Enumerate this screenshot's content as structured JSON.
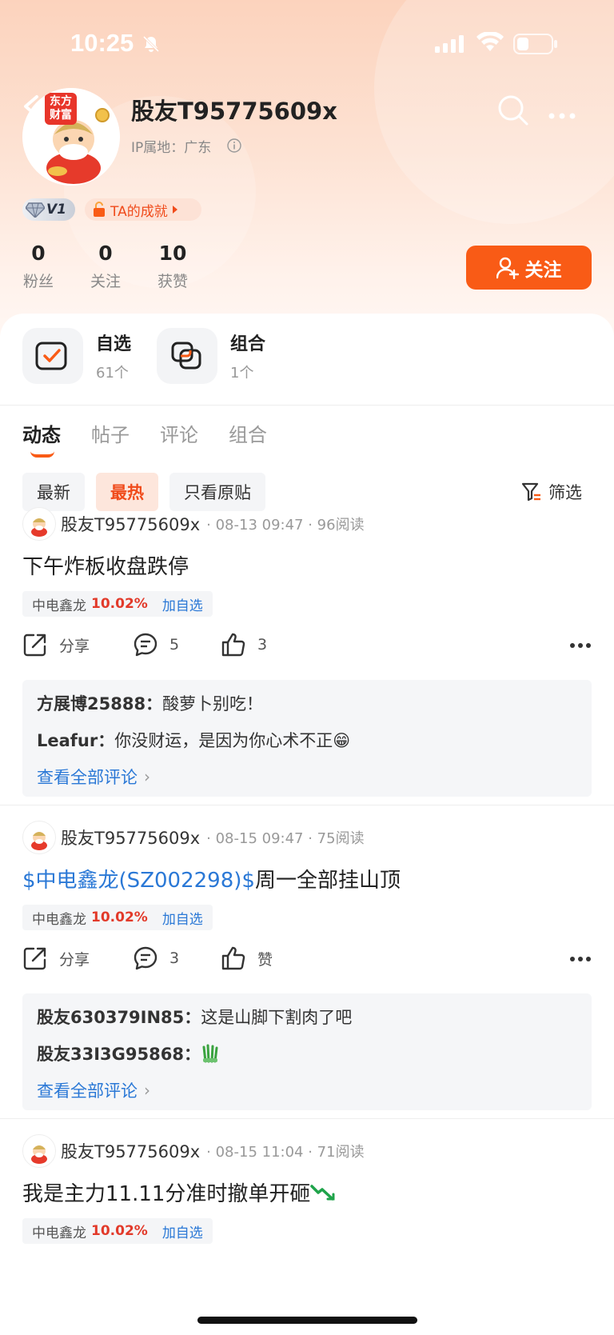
{
  "status_bar": {
    "time": "10:25"
  },
  "profile": {
    "username": "股友T95775609x",
    "ip_location": "IP属地：广东",
    "avatar_tag": "东方财富",
    "level_badge": "V1",
    "achievement_badge": "TA的成就",
    "stats": [
      {
        "value": "0",
        "label": "粉丝"
      },
      {
        "value": "0",
        "label": "关注"
      },
      {
        "value": "10",
        "label": "获赞"
      }
    ],
    "follow_button": "关注"
  },
  "quick_links": [
    {
      "title": "自选",
      "sub": "61个"
    },
    {
      "title": "组合",
      "sub": "1个"
    }
  ],
  "tabs": [
    "动态",
    "帖子",
    "评论",
    "组合"
  ],
  "filters": [
    "最新",
    "最热",
    "只看原贴"
  ],
  "filter_button": "筛选",
  "posts": [
    {
      "author": "股友T95775609x",
      "meta": "· 08-13 09:47 · 96阅读",
      "body": "下午炸板收盘跌停",
      "stock": {
        "name": "中电鑫龙",
        "pct": "10.02%",
        "add": "加自选"
      },
      "share": "分享",
      "comments_count": "5",
      "likes": "3",
      "comments": [
        {
          "author": "方展博25888：",
          "text": "酸萝卜别吃！"
        },
        {
          "author": "Leafur：",
          "text": "你没财运，是因为你心术不正😁"
        }
      ],
      "view_all": "查看全部评论"
    },
    {
      "author": "股友T95775609x",
      "meta": "· 08-15 09:47 · 75阅读",
      "cashtag": "$中电鑫龙(SZ002298)$",
      "body": "周一全部挂山顶",
      "stock": {
        "name": "中电鑫龙",
        "pct": "10.02%",
        "add": "加自选"
      },
      "share": "分享",
      "comments_count": "3",
      "likes": "赞",
      "comments": [
        {
          "author": "股友630379IN85：",
          "text": "这是山脚下割肉了吧"
        },
        {
          "author": "股友33I3G95868：",
          "text": ""
        }
      ],
      "view_all": "查看全部评论"
    },
    {
      "author": "股友T95775609x",
      "meta": "· 08-15 11:04 · 71阅读",
      "body": "我是主力11.11分准时撤单开砸",
      "stock": {
        "name": "中电鑫龙",
        "pct": "10.02%",
        "add": "加自选"
      }
    }
  ],
  "colors": {
    "accent": "#f95b16",
    "link": "#2a78d6",
    "up": "#e23a2a"
  }
}
